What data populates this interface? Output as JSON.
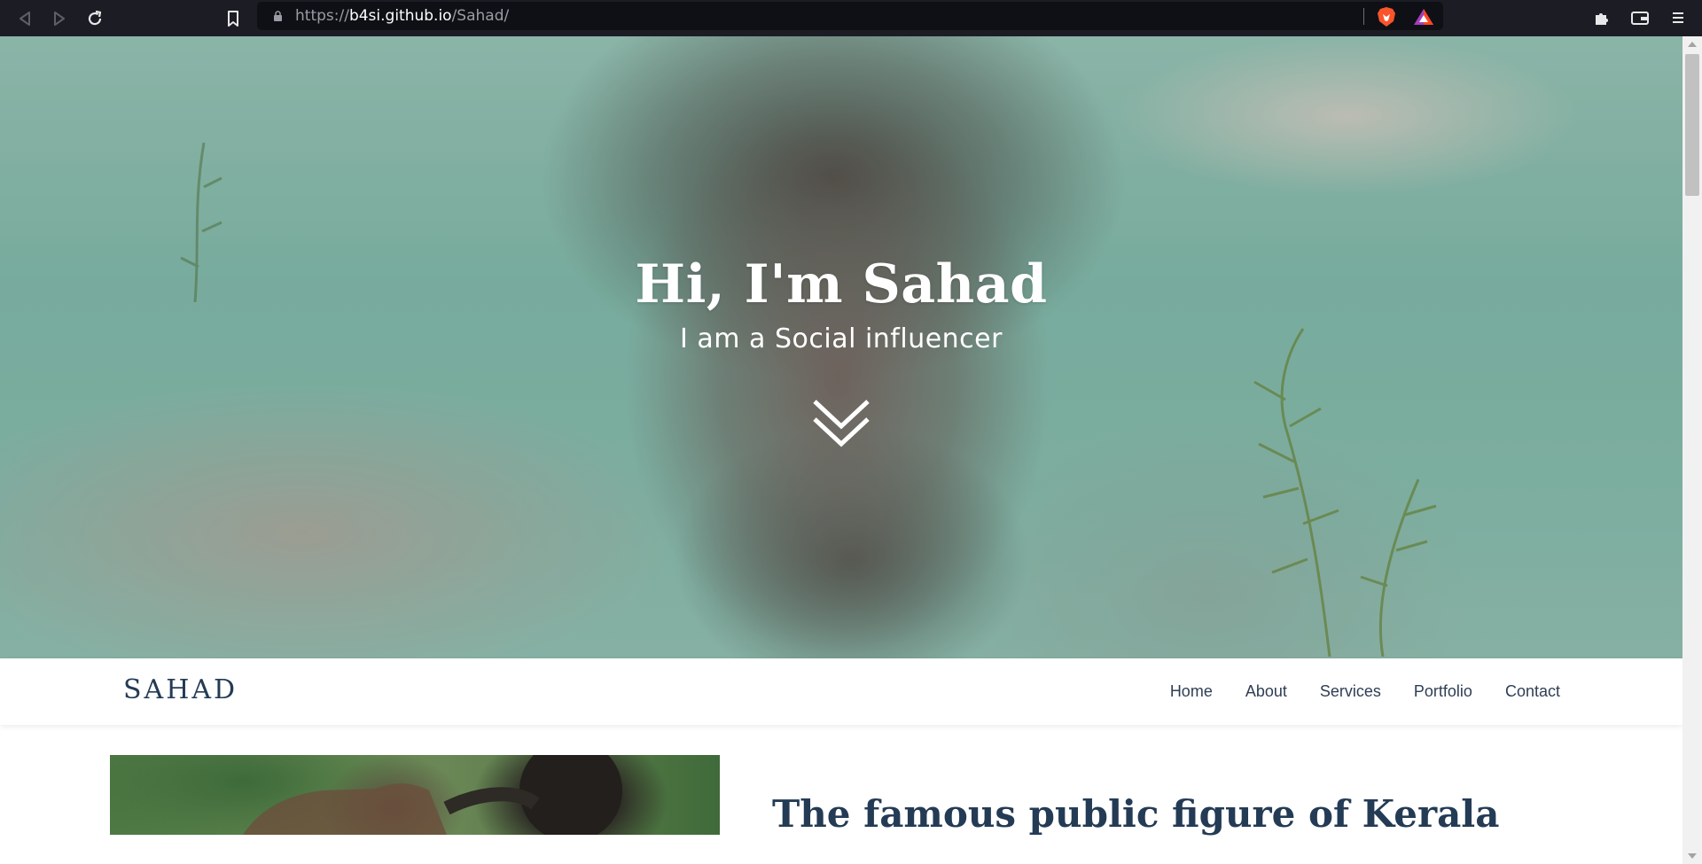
{
  "browser": {
    "url_scheme": "https://",
    "url_host": "b4si.github.io",
    "url_path": "/Sahad/",
    "icons": [
      "back-icon",
      "forward-icon",
      "reload-icon",
      "bookmark-icon",
      "lock-icon",
      "brave-shields-icon",
      "brave-rewards-icon",
      "extensions-icon",
      "wallet-icon",
      "menu-icon"
    ]
  },
  "hero": {
    "title": "Hi, I'm Sahad",
    "subtitle": "I am a Social influencer",
    "scroll_icon": "double-chevron-down-icon"
  },
  "nav": {
    "brand": "SAHAD",
    "links": [
      "Home",
      "About",
      "Services",
      "Portfolio",
      "Contact"
    ]
  },
  "about": {
    "heading": "The famous public figure of Kerala"
  },
  "colors": {
    "brand": "#243b55",
    "nav_text": "#2f3e55",
    "browser_bar": "#1c1d24",
    "url_bar": "#0f1015",
    "hero_water": "#8cc2b2"
  }
}
